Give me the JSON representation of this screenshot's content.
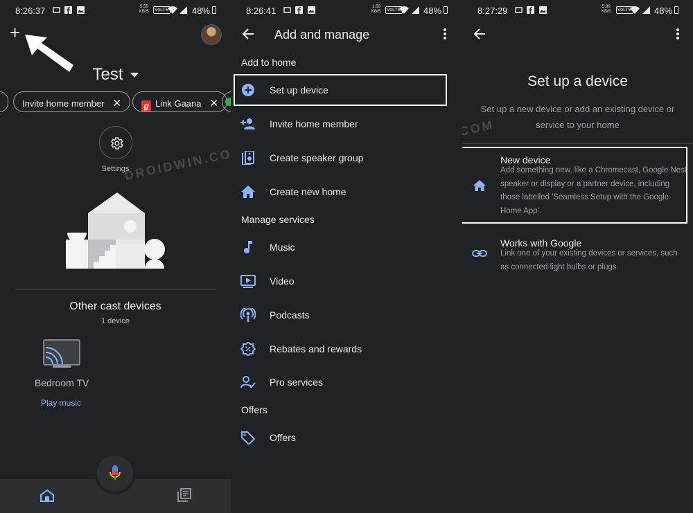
{
  "screens": [
    {
      "status": {
        "time": "8:26:37",
        "speed": [
          "5.55",
          "KB/S"
        ],
        "volte": "VoLTE",
        "battery": "48%"
      },
      "home": {
        "title": "Test",
        "chips": [
          {
            "label": "Invite home member"
          },
          {
            "label": "Link Gaana",
            "logo": "g"
          }
        ],
        "settings_label": "Settings",
        "other_title": "Other cast devices",
        "other_sub": "1 device",
        "device_name": "Bedroom TV",
        "play_music": "Play music"
      }
    },
    {
      "status": {
        "time": "8:26:41",
        "speed": [
          "1.50",
          "KB/S"
        ],
        "volte": "VoLTE",
        "battery": "48%"
      },
      "title": "Add and manage",
      "sections": {
        "add": "Add to home",
        "manage": "Manage services",
        "offers": "Offers"
      },
      "items": {
        "setup": "Set up device",
        "invite": "Invite home member",
        "speaker": "Create speaker group",
        "newhome": "Create new home",
        "music": "Music",
        "video": "Video",
        "podcasts": "Podcasts",
        "rebates": "Rebates and rewards",
        "pro": "Pro services",
        "offers": "Offers"
      }
    },
    {
      "status": {
        "time": "8:27:29",
        "speed": [
          "5.90",
          "KB/S"
        ],
        "volte": "VoLTE",
        "battery": "48%"
      },
      "title": "Set up a device",
      "subtitle": "Set up a new device or add an existing device or service to your home",
      "options": [
        {
          "title": "New device",
          "desc": "Add something new, like a Chromecast, Google Nest speaker or display or a partner device, including those labelled 'Seamless Setup with the Google Home App'."
        },
        {
          "title": "Works with Google",
          "desc": "Link one of your existing devices or services, such as connected light bulbs or plugs."
        }
      ]
    }
  ],
  "watermark": "DROIDWIN.COM",
  "colors": {
    "background": "#202124",
    "accent": "#8ab4f8",
    "highlight": "#ffffff"
  },
  "icons": [
    "plus-icon",
    "arrow-annotation",
    "gear-icon",
    "mic-icon",
    "home-icon",
    "feed-icon",
    "back-arrow-icon",
    "more-vert-icon",
    "add-circle-icon",
    "person-add-icon",
    "speaker-icon",
    "music-note-icon",
    "video-icon",
    "podcast-icon",
    "rebates-icon",
    "pro-services-icon",
    "tag-icon",
    "link-icon"
  ]
}
